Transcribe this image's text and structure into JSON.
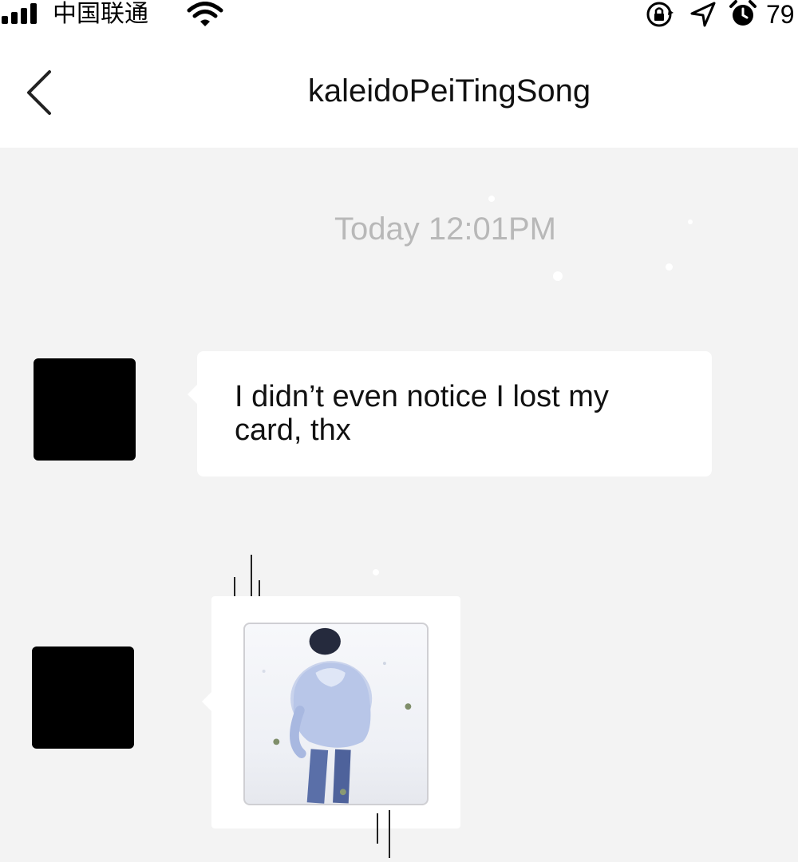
{
  "status_bar": {
    "carrier": "中国联通",
    "battery_text": "79",
    "icons": [
      "signal-icon",
      "wifi-icon",
      "rotation-lock-icon",
      "location-arrow-icon",
      "alarm-icon"
    ]
  },
  "nav": {
    "back_icon": "chevron-left-icon",
    "title": "kaleidoPeiTingSong"
  },
  "chat": {
    "timestamp": "Today 12:01PM",
    "messages": [
      {
        "type": "text",
        "text": "I didn’t even notice I lost my card, thx"
      },
      {
        "type": "image",
        "description_icon": "photo-thumbnail"
      }
    ]
  },
  "colors": {
    "background": "#f3f3f3",
    "bubble": "#ffffff",
    "timestamp": "#b8b8b8",
    "avatar": "#000000",
    "text": "#111111"
  }
}
